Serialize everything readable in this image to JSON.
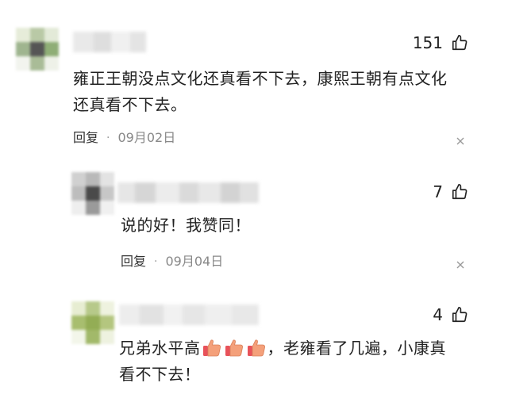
{
  "comments": [
    {
      "likes": "151",
      "text_line1": "雍正王朝没点文化还真看不下去，康熙王朝有点文化",
      "text_line2": "还真看不下去。",
      "reply_label": "回复",
      "dot": "·",
      "date": "09月02日"
    },
    {
      "likes": "7",
      "text_line1": "说的好！我赞同！",
      "reply_label": "回复",
      "dot": "·",
      "date": "09月04日"
    },
    {
      "likes": "4",
      "text_before": "兄弟水平高",
      "text_after": "，老雍看了几遍，小康真",
      "text_line2": "看不下去！"
    }
  ],
  "icons": {
    "like": "thumbs-up-icon",
    "close": "close-icon",
    "emoji": "thumbs-up-emoji-icon"
  },
  "colors": {
    "text": "#222222",
    "meta": "#888888",
    "emoji_skin": "#f4a07a",
    "emoji_cuff": "#e8525a"
  }
}
